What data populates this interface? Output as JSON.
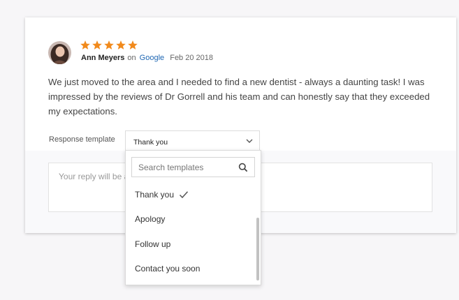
{
  "review": {
    "rating": 5,
    "rating_max": 5,
    "author": "Ann Meyers",
    "on_text": "on",
    "source": "Google",
    "date": "Feb 20 2018",
    "text": "We just moved to the area and I needed to find a new dentist - always a daunting task! I was impressed by the reviews of Dr Gorrell and his team and can honestly say that they exceeded my expectations."
  },
  "response": {
    "label": "Response template",
    "selected": "Thank you",
    "reply_placeholder": "Your reply will be a"
  },
  "dropdown": {
    "search_placeholder": "Search templates",
    "options": [
      "Thank you",
      "Apology",
      "Follow up",
      "Contact you soon"
    ],
    "selected_index": 0
  },
  "colors": {
    "star": "#f18a1c",
    "source_link": "#1f67b3",
    "page_bg": "#f7f6f8"
  },
  "icons": {
    "rating": "star-icon",
    "select": "chevron-down-icon",
    "search": "search-icon",
    "selected": "check-icon"
  }
}
